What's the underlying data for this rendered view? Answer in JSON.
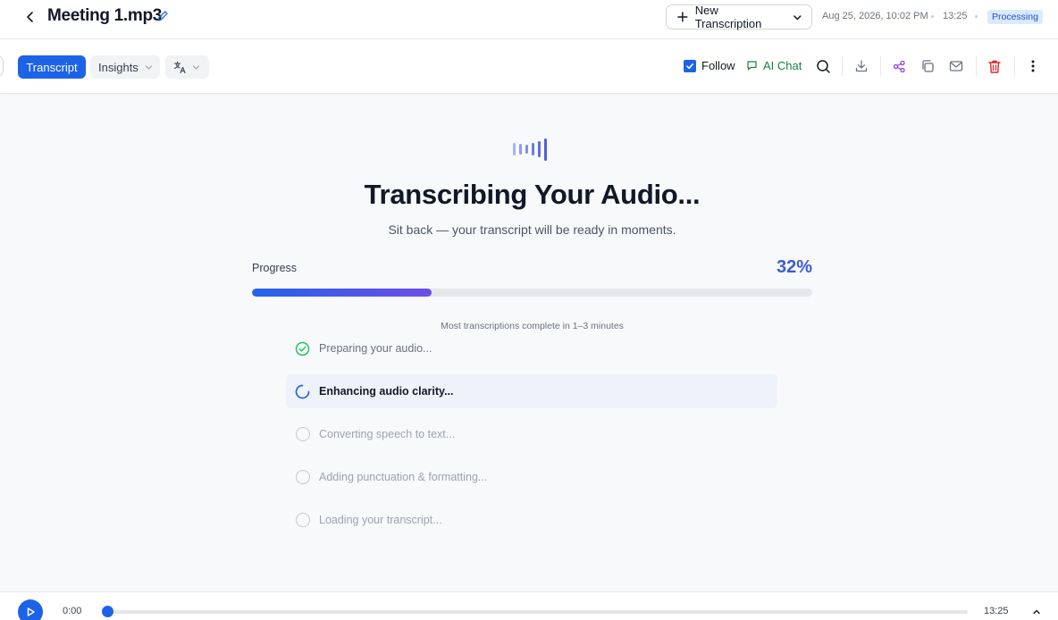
{
  "header": {
    "back_icon": "chevron-left-icon",
    "file_name": "Meeting 1.mp3",
    "edit_icon": "pencil-icon",
    "new_transcription_label": "New Transcription",
    "date": "Aug 25, 2026, 10:02 PM",
    "duration": "13:25",
    "status": "Processing"
  },
  "toolbar": {
    "tabs": [
      {
        "label": "Transcript",
        "active": true
      },
      {
        "label": "Insights",
        "active": false
      }
    ],
    "translate_icon": "translate-icon",
    "follow_label": "Follow",
    "follow_checked": true,
    "ai_chat_label": "AI Chat",
    "icons": [
      "search-icon",
      "download-icon",
      "share-icon",
      "copy-icon",
      "mail-icon",
      "trash-icon",
      "more-vertical-icon"
    ]
  },
  "main": {
    "title": "Transcribing Your Audio...",
    "subtitle": "Sit back — your transcript will be ready in moments.",
    "progress_label": "Progress",
    "progress_percent_text": "32%",
    "progress_fraction": 0.32,
    "eta_note": "Most transcriptions complete in 1–3 minutes",
    "steps": [
      {
        "label": "Preparing your audio...",
        "state": "done"
      },
      {
        "label": "Enhancing audio clarity...",
        "state": "active"
      },
      {
        "label": "Converting speech to text...",
        "state": "pending"
      },
      {
        "label": "Adding punctuation & formatting...",
        "state": "pending"
      },
      {
        "label": "Loading your transcript...",
        "state": "pending"
      }
    ]
  },
  "player": {
    "current_time": "0:00",
    "total_time": "13:25",
    "position_fraction": 0
  },
  "colors": {
    "accent": "#1d63e8",
    "ai_chat": "#15803d",
    "danger": "#dc2626",
    "share": "#9333ea",
    "progress_start": "#2563eb",
    "progress_end": "#6d4de6"
  }
}
